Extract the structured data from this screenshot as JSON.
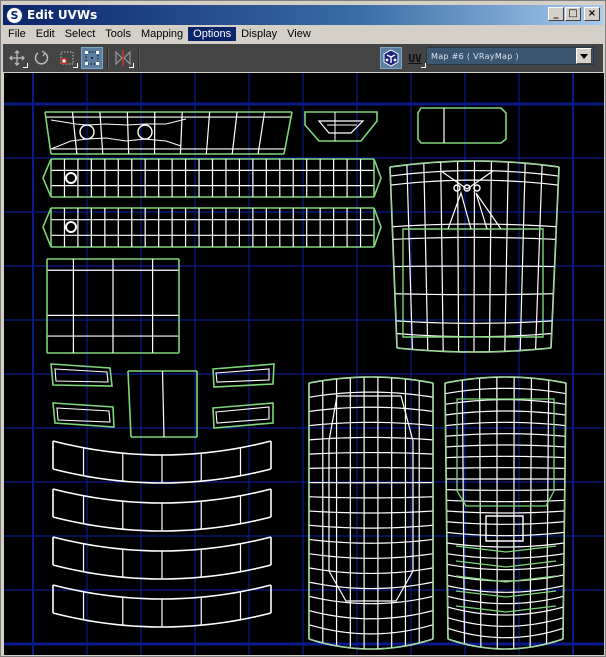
{
  "window": {
    "title": "Edit UVWs",
    "app_icon": "3dsmax-icon",
    "controls": {
      "minimize": "_",
      "maximize": "□",
      "close": "×"
    }
  },
  "menubar": {
    "items": [
      {
        "label": "File",
        "active": false
      },
      {
        "label": "Edit",
        "active": false
      },
      {
        "label": "Select",
        "active": false
      },
      {
        "label": "Tools",
        "active": false
      },
      {
        "label": "Mapping",
        "active": false
      },
      {
        "label": "Options",
        "active": true
      },
      {
        "label": "Display",
        "active": false
      },
      {
        "label": "View",
        "active": false
      }
    ]
  },
  "toolbar": {
    "tools": [
      {
        "name": "move",
        "icon": "move-icon",
        "pressed": false,
        "flyout": true
      },
      {
        "name": "rotate",
        "icon": "rotate-icon",
        "pressed": false,
        "flyout": false
      },
      {
        "name": "scale",
        "icon": "scale-icon",
        "pressed": false,
        "flyout": true
      },
      {
        "name": "freeform",
        "icon": "freeform-icon",
        "pressed": true,
        "flyout": false
      },
      {
        "name": "mirror",
        "icon": "mirror-icon",
        "pressed": false,
        "flyout": true
      }
    ],
    "show_map_button": {
      "icon": "show-map-icon",
      "pressed": true
    },
    "uv_axis": {
      "label": "UV",
      "icon": "uv-axis-icon",
      "flyout": true
    },
    "map_dropdown": {
      "selected": "Map #6  ( VRayMap )"
    }
  },
  "viewport": {
    "colors": {
      "background": "#000000",
      "grid": "#0b1a8a",
      "grid_boundary": "#0d1f9c",
      "edges": "#ffffff",
      "seams": "#7ed67a"
    },
    "grid_divisions": 10
  }
}
